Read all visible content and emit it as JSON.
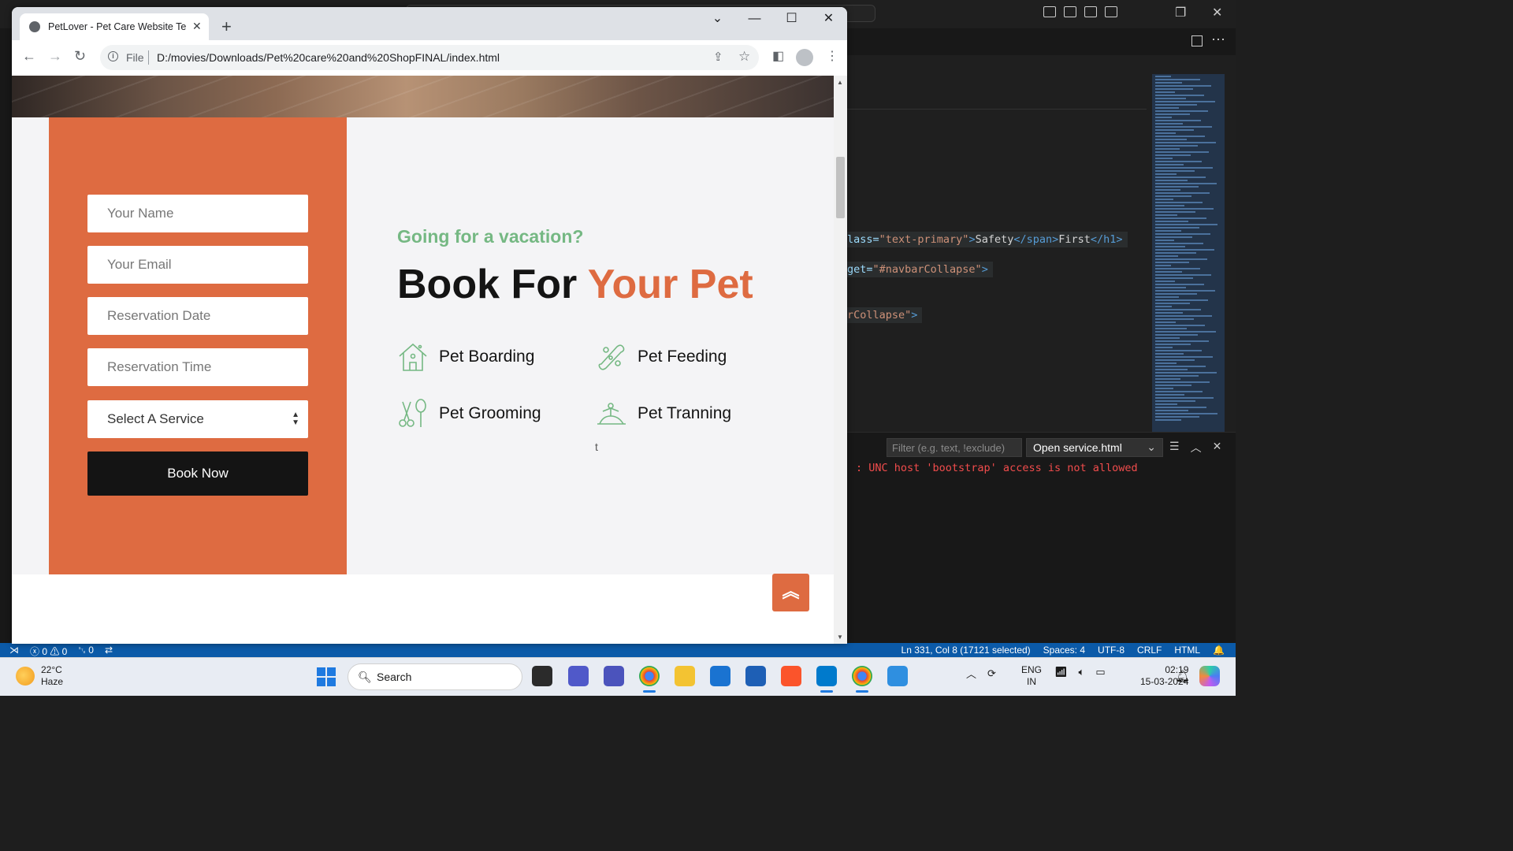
{
  "browser": {
    "tab_title": "PetLover - Pet Care Website Tem",
    "url_scheme": "File",
    "url": "D:/movies/Downloads/Pet%20care%20and%20ShopFINAL/index.html",
    "icons": {
      "back": "arrow-left-icon",
      "forward": "arrow-right-icon",
      "reload": "reload-icon",
      "share": "share-icon",
      "bookmark": "star-icon",
      "side_panel": "side-panel-icon",
      "profile": "profile-icon",
      "menu": "kebab-menu-icon"
    }
  },
  "page": {
    "form": {
      "name_placeholder": "Your Name",
      "email_placeholder": "Your Email",
      "date_placeholder": "Reservation Date",
      "time_placeholder": "Reservation Time",
      "service_select": "Select A Service",
      "submit_label": "Book Now"
    },
    "subtitle": "Going for a vacation?",
    "headline_part1": "Book For ",
    "headline_accent": "Your Pet",
    "services": [
      {
        "label": "Pet Boarding",
        "icon": "pet-house-icon"
      },
      {
        "label": "Pet Feeding",
        "icon": "pet-food-icon"
      },
      {
        "label": "Pet Grooming",
        "icon": "scissors-brush-icon"
      },
      {
        "label": "Pet Tranning",
        "icon": "pet-training-icon"
      }
    ],
    "stray_text": "t",
    "back_to_top_icon": "double-chevron-up-icon",
    "colors": {
      "accent": "#de6b41",
      "green": "#75b883",
      "dark": "#141414"
    }
  },
  "vscode": {
    "code_lines": [
      {
        "attr": "lass=",
        "str": "\"text-primary\"",
        "tag1": ">",
        "tagname": "Safety",
        "tag2": "</span>",
        "txt": "First",
        "tag3": "</h1>"
      },
      {
        "attr": "get=",
        "str": "\"#navbarCollapse\"",
        "tag1": ">"
      },
      {
        "str": "rCollapse\"",
        "tag1": ">"
      }
    ],
    "filter_placeholder": "Filter (e.g. text, !exclude)",
    "output_channel": "Open service.html",
    "error_text": ": UNC host 'bootstrap' access is not allowed",
    "status": {
      "errors": "ⓧ 0 ⚠ 0",
      "ports": "␂ 0",
      "position": "Ln 331, Col 8 (17121 selected)",
      "spaces": "Spaces: 4",
      "encoding": "UTF-8",
      "eol": "CRLF",
      "language": "HTML"
    }
  },
  "taskbar": {
    "temperature": "22°C",
    "weather": "Haze",
    "search_label": "Search",
    "lang_top": "ENG",
    "lang_bottom": "IN",
    "time": "02:19",
    "date": "15-03-2024"
  }
}
